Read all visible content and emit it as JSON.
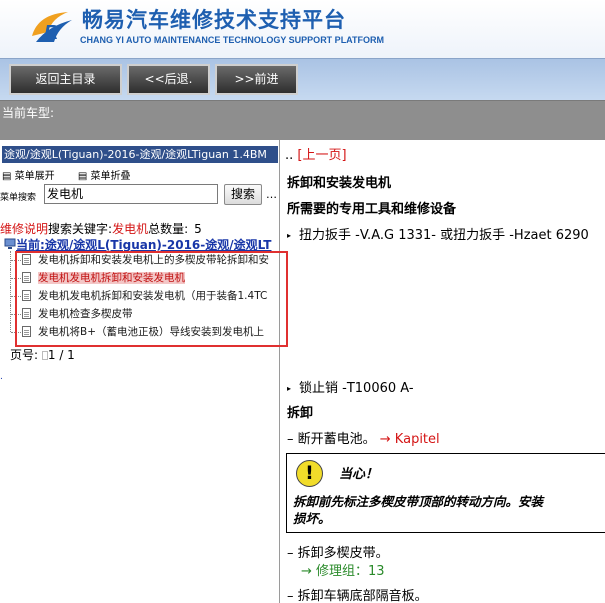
{
  "header": {
    "title": "畅易汽车维修技术支持平台",
    "subtitle": "CHANG YI AUTO MAINTENANCE TECHNOLOGY SUPPORT PLATFORM"
  },
  "toolbar": {
    "home_label": "返回主目录",
    "back_label": "<<后退.",
    "forward_label": ">>前进"
  },
  "car_bar": {
    "label": "当前车型:"
  },
  "left_panel": {
    "path_text": "途观/途观L(Tiguan)-2016-途观/途观LTiguan 1.4BM",
    "expand_label": "菜单展开",
    "collapse_label": "菜单折叠",
    "search_label": "菜单搜索",
    "search_value": "发电机",
    "search_button": "搜索",
    "search_more": "…",
    "count_prefix": "维修说明",
    "count_keyword_label": "搜索关键字:",
    "count_keyword": "发电机",
    "count_total_label": "总数量:",
    "count_total": "5",
    "tree_root_prefix": "当前:",
    "tree_root": "途观/途观L(Tiguan)-2016-途观/途观LT",
    "results": [
      "发电机拆卸和安装发电机上的多楔皮带轮拆卸和安",
      "发电机发电机拆卸和安装发电机",
      "发电机发电机拆卸和安装发电机（用于装备1.4TC",
      "发电机检查多楔皮带",
      "发电机将B+（蓄电池正极）导线安装到发电机上"
    ],
    "page_label": "页号:",
    "page_value": "1 / 1",
    "page_dot": "."
  },
  "content": {
    "prev_link": "[上一页]",
    "prev_prefix": "..",
    "h1": "拆卸和安装发电机",
    "h2": "所需要的专用工具和维修设备",
    "tool1": "扭力扳手 -V.A.G 1331- 或扭力扳手 -Hzaet 6290",
    "tool2": "锁止销 -T10060 A-",
    "h3": "拆卸",
    "step1_prefix": "– 断开蓄电池。",
    "step1_link": "→ Kapitel",
    "caution_title": "当心！",
    "caution_line1": "拆卸前先标注多楔皮带顶部的转动方向。安装",
    "caution_line2": "损坏。",
    "step2": "– 拆卸多楔皮带。",
    "step2_link": "→ 修理组：13",
    "step3": "– 拆卸车辆底部隔音板。"
  }
}
